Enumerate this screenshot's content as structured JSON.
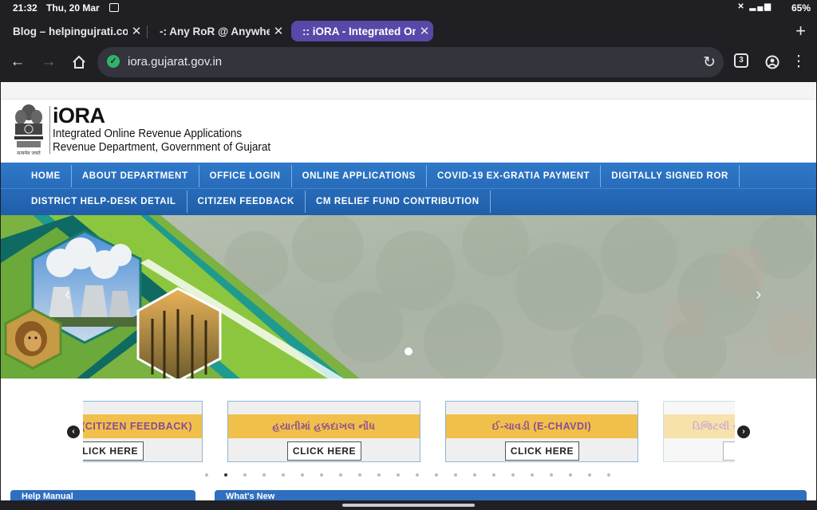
{
  "status_bar": {
    "time": "21:32",
    "date": "Thu, 20 Mar",
    "battery": "65%"
  },
  "browser": {
    "tabs": [
      {
        "label": "Blog – helpingujrati.com",
        "active": false
      },
      {
        "label": "-: Any RoR @ Anywhere",
        "active": false
      },
      {
        "label": ":: iORA - Integrated Online",
        "active": true
      }
    ],
    "url": "iora.gujarat.gov.in",
    "tab_count": "3"
  },
  "header": {
    "emblem_motto": "सत्यमेव जयते",
    "name": "iORA",
    "subtitle": "Integrated Online Revenue Applications",
    "department": "Revenue Department, Government of Gujarat"
  },
  "nav": {
    "row1": [
      "HOME",
      "ABOUT DEPARTMENT",
      "OFFICE LOGIN",
      "ONLINE APPLICATIONS",
      "COVID-19 EX-GRATIA PAYMENT",
      "DIGITALLY SIGNED ROR"
    ],
    "row2": [
      "DISTRICT HELP-DESK DETAIL",
      "CITIZEN FEEDBACK",
      "CM RELIEF FUND CONTRIBUTION"
    ]
  },
  "hero": {
    "prev_glyph": "‹",
    "next_glyph": "›"
  },
  "cards": [
    {
      "title": "(CITIZEN FEEDBACK)",
      "button": "CLICK HERE"
    },
    {
      "title": "હયાતીમાં હક્કદાખલ નોંધ",
      "button": "CLICK HERE"
    },
    {
      "title": "ઈ-ચાવડી (E-CHAVDI)",
      "button": "CLICK HERE"
    },
    {
      "title": "ડિજિટલી સ",
      "button": "C"
    }
  ],
  "carousel": {
    "prev_glyph": "‹",
    "next_glyph": "›",
    "dot_count": 22,
    "active_dot": 1
  },
  "panels": {
    "left_title": "Help Manual",
    "right_title": "What's New"
  },
  "colors": {
    "nav_blue": "#2f79c9",
    "card_band": "#f0c04a",
    "card_text": "#8b4b93",
    "active_tab": "#5848a8"
  }
}
